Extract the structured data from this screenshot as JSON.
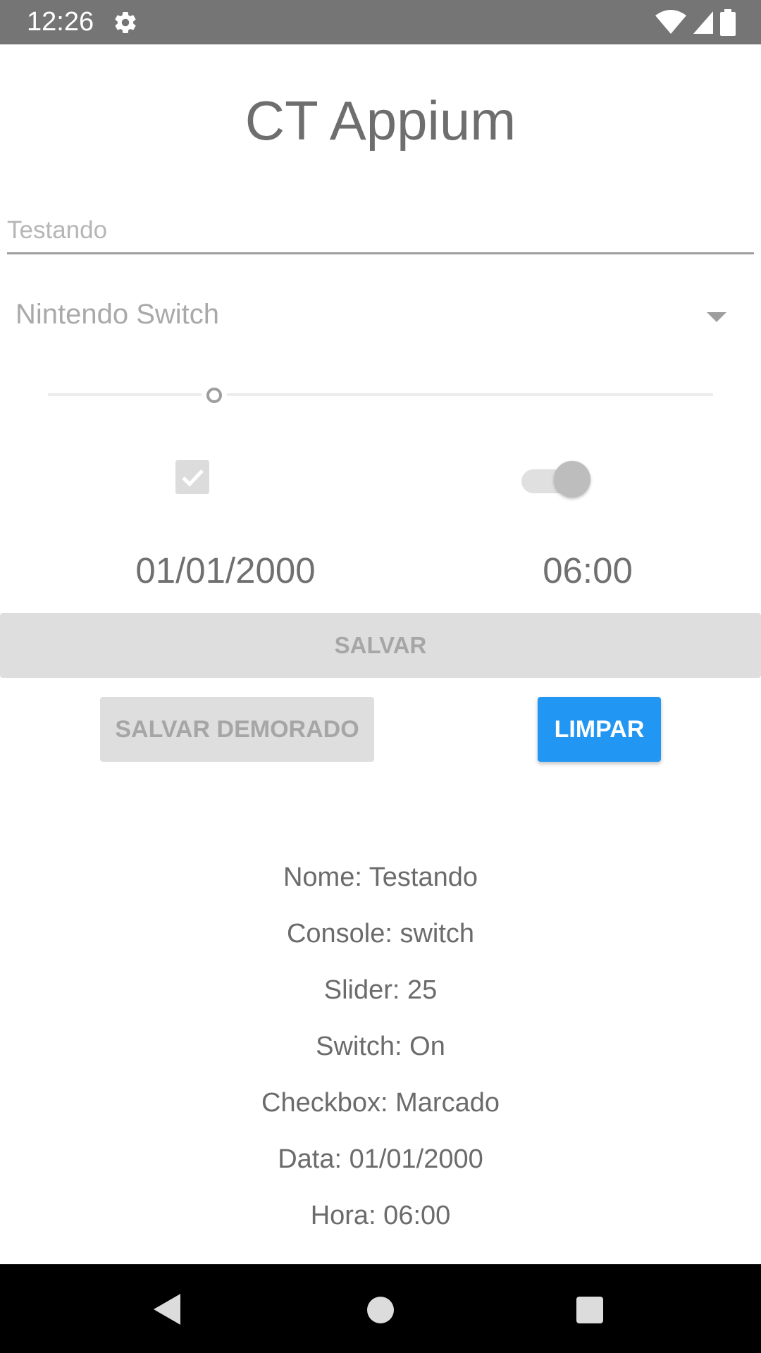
{
  "status_bar": {
    "time": "12:26",
    "icons": [
      "gear-icon",
      "wifi-icon",
      "cellular-signal-icon",
      "battery-icon"
    ],
    "background_color": "#757575"
  },
  "app": {
    "title": "CT Appium"
  },
  "form": {
    "name_input": {
      "value": "Testando",
      "placeholder": ""
    },
    "console_select": {
      "selected": "Nintendo Switch"
    },
    "slider": {
      "value_fraction": 0.25
    },
    "checkbox": {
      "checked": true
    },
    "switch": {
      "on": true
    },
    "date": "01/01/2000",
    "time": "06:00"
  },
  "buttons": {
    "save_label": "SALVAR",
    "save_delayed_label": "SALVAR DEMORADO",
    "clear_label": "LIMPAR",
    "clear_color": "#2196F3"
  },
  "results": [
    "Nome: Testando",
    "Console: switch",
    "Slider: 25",
    "Switch: On",
    "Checkbox: Marcado",
    "Data: 01/01/2000",
    "Hora: 06:00"
  ],
  "nav_bar": {
    "icons": [
      "back-icon",
      "home-icon",
      "recents-icon"
    ]
  }
}
